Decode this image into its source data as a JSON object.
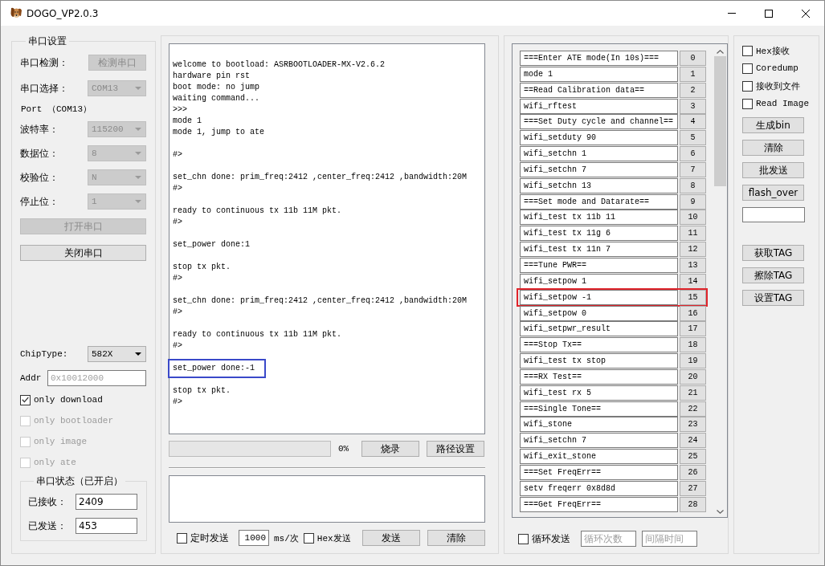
{
  "window": {
    "title": "DOGO_VP2.0.3"
  },
  "serial_settings": {
    "title": "串口设置",
    "rows": [
      {
        "kind": "button",
        "label": "串口检测：",
        "value": "检测串口",
        "disabled": true
      },
      {
        "kind": "combo",
        "label": "串口选择：",
        "value": "COM13",
        "disabled": true
      },
      {
        "kind": "note",
        "label": "Port （COM13）"
      },
      {
        "kind": "combo",
        "label": "波特率：",
        "value": "115200",
        "disabled": true
      },
      {
        "kind": "combo",
        "label": "数据位：",
        "value": "8",
        "disabled": true
      },
      {
        "kind": "combo",
        "label": "校验位：",
        "value": "N",
        "disabled": true
      },
      {
        "kind": "combo",
        "label": "停止位：",
        "value": "1",
        "disabled": true
      }
    ],
    "buttons": [
      {
        "label": "打开串口",
        "disabled": true
      },
      {
        "label": "关闭串口",
        "disabled": false
      }
    ],
    "chip_type": {
      "label": "ChipType:",
      "value": "582X",
      "disabled": false
    },
    "addr": {
      "label": "Addr",
      "placeholder": "0x10012000"
    },
    "options": [
      {
        "label": "only download",
        "checked": true,
        "disabled": false
      },
      {
        "label": "only bootloader",
        "checked": false,
        "disabled": true
      },
      {
        "label": "only image",
        "checked": false,
        "disabled": true
      },
      {
        "label": "only ate",
        "checked": false,
        "disabled": true
      }
    ],
    "status": {
      "title": "串口状态（已开启）",
      "rows": [
        {
          "label": "已接收：",
          "value": "2409"
        },
        {
          "label": "已发送：",
          "value": "453"
        }
      ]
    }
  },
  "terminal": {
    "blocks": [
      {
        "lines": [
          "welcome to bootload: ASRBOOTLOADER-MX-V2.6.2",
          "hardware pin rst",
          "boot mode: no jump",
          "waiting command...",
          ">>>",
          "mode 1",
          "mode 1, jump to ate"
        ],
        "highlighted": false
      },
      {
        "lines": [
          "#>"
        ],
        "highlighted": false
      },
      {
        "lines": [
          "set_chn done: prim_freq:2412 ,center_freq:2412 ,bandwidth:20M",
          "#>"
        ],
        "highlighted": false
      },
      {
        "lines": [
          "ready to continuous tx 11b 11M pkt.",
          "#>"
        ],
        "highlighted": false
      },
      {
        "lines": [
          "set_power done:1"
        ],
        "highlighted": false
      },
      {
        "lines": [
          "stop tx pkt.",
          "#>"
        ],
        "highlighted": false
      },
      {
        "lines": [
          "set_chn done: prim_freq:2412 ,center_freq:2412 ,bandwidth:20M",
          "#>"
        ],
        "highlighted": false
      },
      {
        "lines": [
          "ready to continuous tx 11b 11M pkt.",
          "#>"
        ],
        "highlighted": false
      },
      {
        "lines": [
          "set_power done:-1"
        ],
        "highlighted": true
      },
      {
        "lines": [
          "stop tx pkt.",
          "#>"
        ],
        "highlighted": false
      }
    ]
  },
  "flash": {
    "progress": {
      "level": 0,
      "reading": "0%"
    },
    "buttons": [
      "烧录",
      "路径设置"
    ]
  },
  "send": {
    "timer": {
      "label": "定时发送",
      "checked": false
    },
    "interval": {
      "value": "1000",
      "unit": "ms/次"
    },
    "hex": {
      "label": "Hex发送",
      "checked": false
    },
    "buttons": [
      "发送",
      "清除"
    ]
  },
  "commands": {
    "items": [
      {
        "command": "===Enter ATE mode(In 10s)===",
        "number": "0",
        "highlighted": false
      },
      {
        "command": "mode 1",
        "number": "1",
        "highlighted": false
      },
      {
        "command": "==Read Calibration data==",
        "number": "2",
        "highlighted": false
      },
      {
        "command": "wifi_rftest",
        "number": "3",
        "highlighted": false
      },
      {
        "command": "===Set Duty cycle and channel==",
        "number": "4",
        "highlighted": false
      },
      {
        "command": "wifi_setduty 90",
        "number": "5",
        "highlighted": false
      },
      {
        "command": "wifi_setchn 1",
        "number": "6",
        "highlighted": false
      },
      {
        "command": "wifi_setchn 7",
        "number": "7",
        "highlighted": false
      },
      {
        "command": "wifi_setchn 13",
        "number": "8",
        "highlighted": false
      },
      {
        "command": "===Set mode and Datarate==",
        "number": "9",
        "highlighted": false
      },
      {
        "command": "wifi_test tx 11b 11",
        "number": "10",
        "highlighted": false
      },
      {
        "command": "wifi_test tx 11g 6",
        "number": "11",
        "highlighted": false
      },
      {
        "command": "wifi_test tx 11n 7",
        "number": "12",
        "highlighted": false
      },
      {
        "command": "===Tune PWR==",
        "number": "13",
        "highlighted": false
      },
      {
        "command": "wifi_setpow 1",
        "number": "14",
        "highlighted": false
      },
      {
        "command": "wifi_setpow -1",
        "number": "15",
        "highlighted": true
      },
      {
        "command": "wifi_setpow 0",
        "number": "16",
        "highlighted": false
      },
      {
        "command": "wifi_setpwr_result",
        "number": "17",
        "highlighted": false
      },
      {
        "command": "===Stop Tx==",
        "number": "18",
        "highlighted": false
      },
      {
        "command": "wifi_test tx stop",
        "number": "19",
        "highlighted": false
      },
      {
        "command": "===RX Test==",
        "number": "20",
        "highlighted": false
      },
      {
        "command": "wifi_test rx 5",
        "number": "21",
        "highlighted": false
      },
      {
        "command": "===Single Tone==",
        "number": "22",
        "highlighted": false
      },
      {
        "command": "wifi_stone",
        "number": "23",
        "highlighted": false
      },
      {
        "command": "wifi_setchn 7",
        "number": "24",
        "highlighted": false
      },
      {
        "command": "wifi_exit_stone",
        "number": "25",
        "highlighted": false
      },
      {
        "command": "===Set FreqErr==",
        "number": "26",
        "highlighted": false
      },
      {
        "command": "setv freqerr 0x8d8d",
        "number": "27",
        "highlighted": false
      },
      {
        "command": "===Get FreqErr==",
        "number": "28",
        "highlighted": false
      }
    ],
    "loop": {
      "label": "循环发送",
      "checked": false
    },
    "fields": [
      {
        "placeholder": "循环次数"
      },
      {
        "placeholder": "间隔时间"
      }
    ]
  },
  "tools": {
    "options": [
      {
        "label": "Hex接收",
        "checked": false
      },
      {
        "label": "Coredump",
        "checked": false
      },
      {
        "label": "接收到文件",
        "checked": false
      },
      {
        "label": "Read Image",
        "checked": false
      }
    ],
    "buttons": [
      "生成bin",
      "清除",
      "批发送",
      "flash_over"
    ],
    "tag_buttons": [
      "获取TAG",
      "擦除TAG",
      "设置TAG"
    ]
  }
}
